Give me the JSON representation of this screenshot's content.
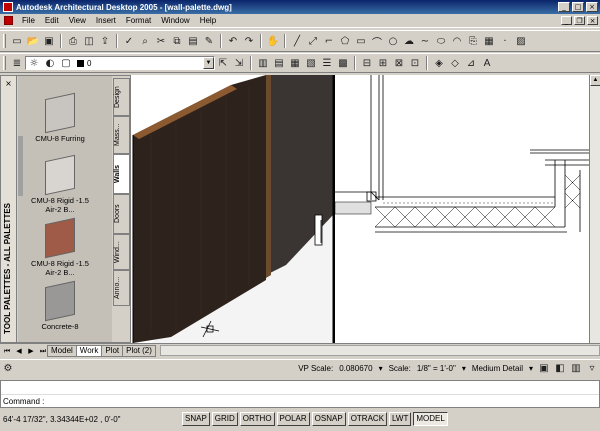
{
  "window": {
    "title": "Autodesk Architectural Desktop 2005 - [wall-palette.dwg]"
  },
  "menu": [
    "File",
    "Edit",
    "View",
    "Insert",
    "Format",
    "Window",
    "Help"
  ],
  "layer_combo": {
    "value": "0"
  },
  "palette": {
    "title": "TOOL PALETTES - ALL PALETTES",
    "tools": [
      {
        "label": "CMU-8 Furring",
        "color": "#c8c4c0"
      },
      {
        "label": "CMU-8 Rigid -1.5 Air-2 B...",
        "color": "#d8d4d0"
      },
      {
        "label": "CMU-8 Rigid -1.5 Air-2 B...",
        "color": "#a05a48"
      },
      {
        "label": "Concrete-8",
        "color": "#9a9896"
      }
    ],
    "tabs": [
      "Design",
      "Mass...",
      "Walls",
      "Doors",
      "Wind...",
      "Anno..."
    ],
    "active_tab": "Walls"
  },
  "layout_tabs": [
    "Model",
    "Work",
    "Plot",
    "Plot (2)"
  ],
  "active_layout": "Work",
  "status": {
    "vp_scale_label": "VP Scale:",
    "vp_scale_value": "0.080670",
    "scale_label": "Scale:",
    "scale_value": "1/8\" = 1'-0\"",
    "detail": "Medium Detail"
  },
  "command": {
    "line1": "",
    "line2": "Command :"
  },
  "coordinates": "64'-4 17/32\", 3.34344E+02 , 0'-0\"",
  "toggles": [
    {
      "label": "SNAP",
      "on": false
    },
    {
      "label": "GRID",
      "on": false
    },
    {
      "label": "ORTHO",
      "on": false
    },
    {
      "label": "POLAR",
      "on": false
    },
    {
      "label": "OSNAP",
      "on": false
    },
    {
      "label": "OTRACK",
      "on": false
    },
    {
      "label": "LWT",
      "on": false
    },
    {
      "label": "MODEL",
      "on": true
    }
  ]
}
